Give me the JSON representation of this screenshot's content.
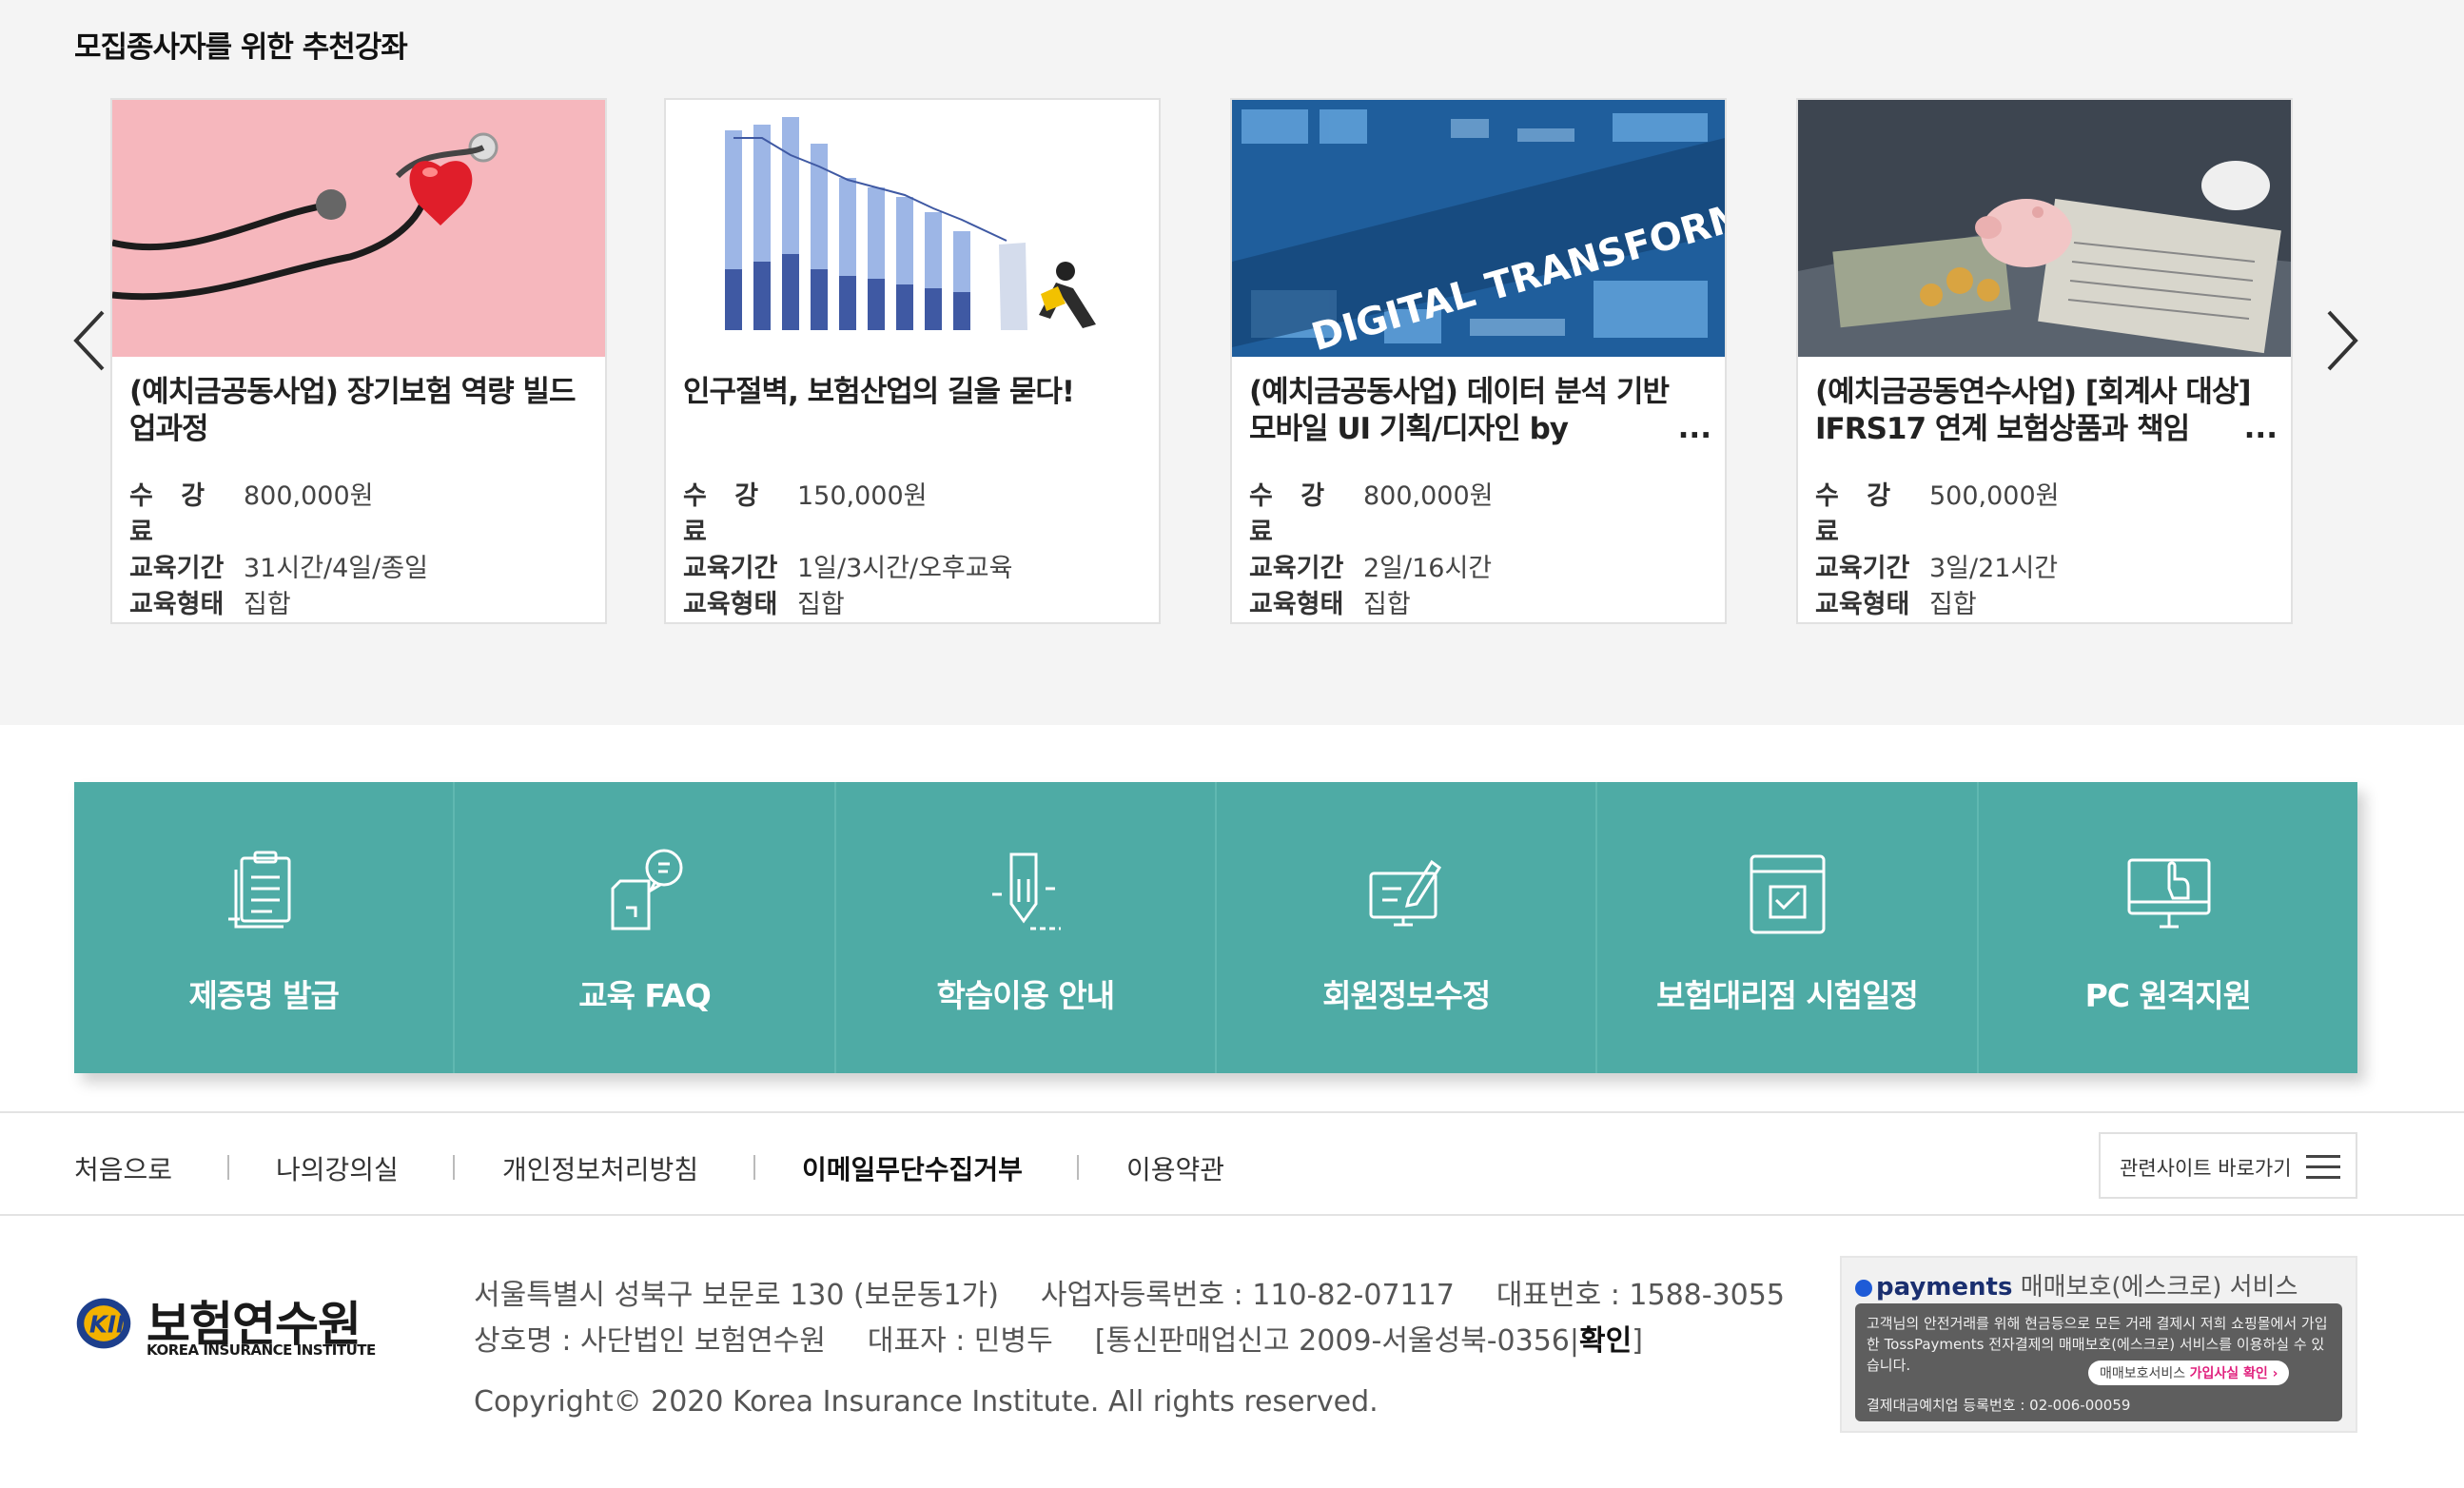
{
  "section": {
    "title": "모집종사자를 위한 추천강좌"
  },
  "labels": {
    "fee": "수 강 료",
    "period": "교육기간",
    "type": "교육형태"
  },
  "courses": [
    {
      "title": "(예치금공동사업) 장기보험 역량 빌드업과정",
      "fee": "800,000원",
      "period": "31시간/4일/종일",
      "type": "집합",
      "ellipsis": ""
    },
    {
      "title": "인구절벽, 보험산업의 길을 묻다!",
      "fee": "150,000원",
      "period": "1일/3시간/오후교육",
      "type": "집합",
      "ellipsis": ""
    },
    {
      "title": "(예치금공동사업) 데이터 분석 기반 모바일 UI 기획/디자인 by",
      "fee": "800,000원",
      "period": "2일/16시간",
      "type": "집합",
      "ellipsis": "...",
      "thumb_text": "DIGITAL TRANSFORMATION"
    },
    {
      "title": "(예치금공동연수사업) [회계사 대상] IFRS17 연계 보험상품과 책임",
      "fee": "500,000원",
      "period": "3일/21시간",
      "type": "집합",
      "ellipsis": "..."
    }
  ],
  "quick_menu": [
    {
      "label": "제증명 발급",
      "icon": "certificate-icon"
    },
    {
      "label": "교육 FAQ",
      "icon": "faq-icon"
    },
    {
      "label": "학습이용 안내",
      "icon": "pen-guide-icon"
    },
    {
      "label": "회원정보수정",
      "icon": "member-edit-icon"
    },
    {
      "label": "보험대리점 시험일정",
      "icon": "calendar-check-icon"
    },
    {
      "label": "PC 원격지원",
      "icon": "remote-pc-icon"
    }
  ],
  "footer_links": [
    {
      "label": "처음으로"
    },
    {
      "label": "나의강의실"
    },
    {
      "label": "개인정보처리방침"
    },
    {
      "label": "이메일무단수집거부"
    },
    {
      "label": "이용약관"
    }
  ],
  "related_sites": "관련사이트 바로가기",
  "logo": {
    "name": "보험연수원",
    "sub": "KOREA INSURANCE INSTITUTE",
    "mark": "KII"
  },
  "footer": {
    "address": "서울특별시 성북구 보문로 130 (보문동1가)",
    "biz_no": "사업자등록번호 : 110-82-07117",
    "phone": "대표번호 : 1588-3055",
    "company": "상호명 : 사단법인 보험연수원",
    "ceo": "대표자 : 민병두",
    "telecom_prefix": "[통신판매업신고 2009-서울성북-0356|",
    "telecom_confirm": "확인",
    "telecom_suffix": "]",
    "copyright": "Copyright© 2020 Korea Insurance Institute. All rights reserved."
  },
  "escrow": {
    "brand": "payments",
    "title": "매매보호(에스크로) 서비스",
    "desc": "고객님의 안전거래를 위해 현금등으로 모든 거래 결제시 저희 쇼핑몰에서 가입한 TossPayments 전자결제의 매매보호(에스크로) 서비스를 이용하실 수 있습니다.",
    "pill_prefix": "매매보호서비스",
    "pill_link": "가입사실 확인 ›",
    "reg": "결제대금예치업 등록번호 : 02-006-00059"
  }
}
